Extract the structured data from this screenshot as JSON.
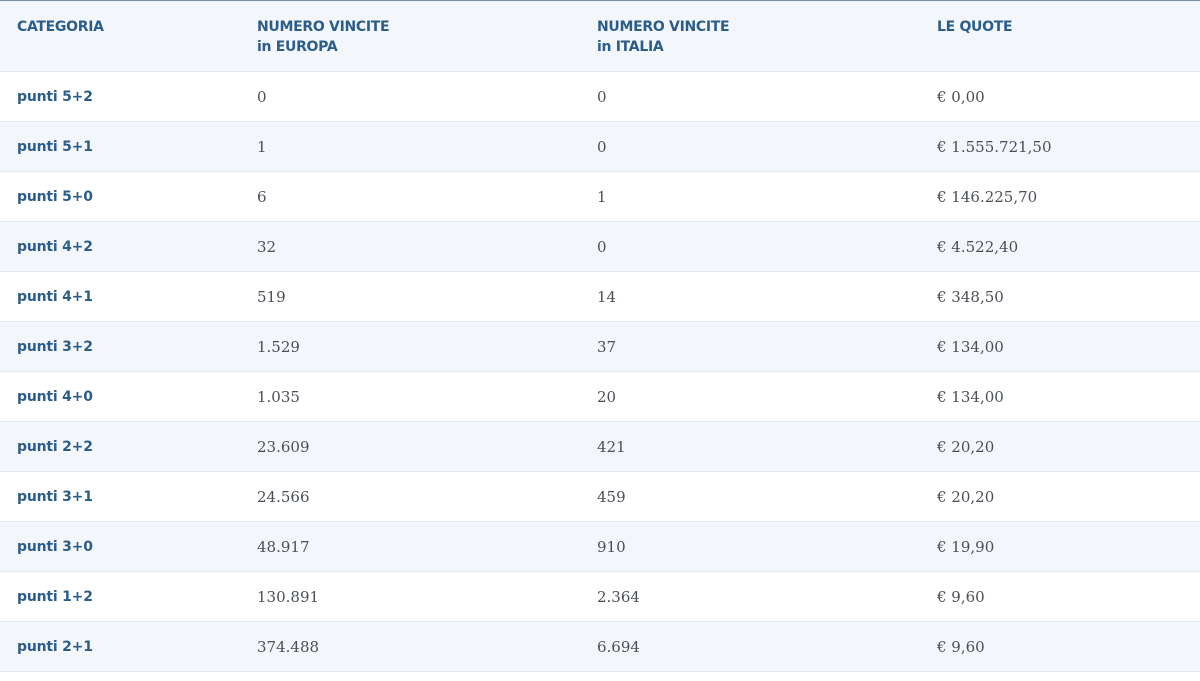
{
  "table": {
    "headers": {
      "categoria": "CATEGORIA",
      "europa_line1": "NUMERO VINCITE",
      "europa_line2": "in EUROPA",
      "italia_line1": "NUMERO VINCITE",
      "italia_line2": "in ITALIA",
      "quote": "LE QUOTE"
    },
    "rows": [
      {
        "categoria": "punti 5+2",
        "europa": "0",
        "italia": "0",
        "quota": "€ 0,00"
      },
      {
        "categoria": "punti 5+1",
        "europa": "1",
        "italia": "0",
        "quota": "€ 1.555.721,50"
      },
      {
        "categoria": "punti 5+0",
        "europa": "6",
        "italia": "1",
        "quota": "€ 146.225,70"
      },
      {
        "categoria": "punti 4+2",
        "europa": "32",
        "italia": "0",
        "quota": "€ 4.522,40"
      },
      {
        "categoria": "punti 4+1",
        "europa": "519",
        "italia": "14",
        "quota": "€ 348,50"
      },
      {
        "categoria": "punti 3+2",
        "europa": "1.529",
        "italia": "37",
        "quota": "€ 134,00"
      },
      {
        "categoria": "punti 4+0",
        "europa": "1.035",
        "italia": "20",
        "quota": "€ 134,00"
      },
      {
        "categoria": "punti 2+2",
        "europa": "23.609",
        "italia": "421",
        "quota": "€ 20,20"
      },
      {
        "categoria": "punti 3+1",
        "europa": "24.566",
        "italia": "459",
        "quota": "€ 20,20"
      },
      {
        "categoria": "punti 3+0",
        "europa": "48.917",
        "italia": "910",
        "quota": "€ 19,90"
      },
      {
        "categoria": "punti 1+2",
        "europa": "130.891",
        "italia": "2.364",
        "quota": "€ 9,60"
      },
      {
        "categoria": "punti 2+1",
        "europa": "374.488",
        "italia": "6.694",
        "quota": "€ 9,60"
      }
    ]
  }
}
